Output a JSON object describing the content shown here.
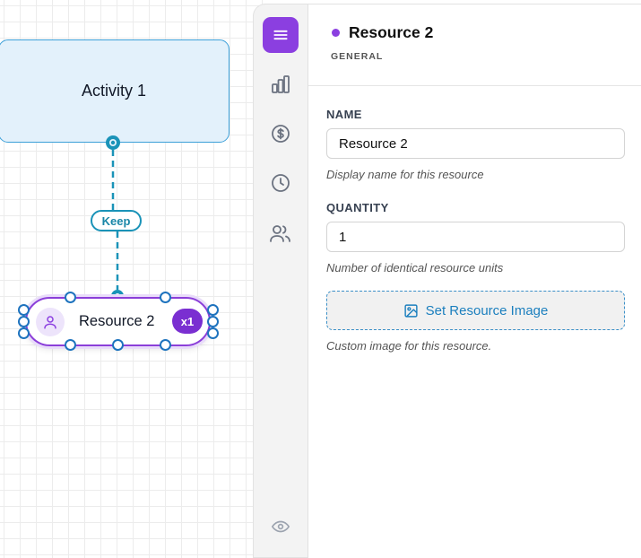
{
  "canvas": {
    "activity_label": "Activity 1",
    "connector_label": "Keep",
    "resource": {
      "label": "Resource 2",
      "quantity_badge": "x1"
    }
  },
  "toolbar": {
    "items": [
      {
        "icon": "menu-icon",
        "active": true
      },
      {
        "icon": "bar-chart-icon"
      },
      {
        "icon": "dollar-icon"
      },
      {
        "icon": "clock-icon"
      },
      {
        "icon": "users-icon"
      },
      {
        "icon": "eye-icon"
      }
    ]
  },
  "panel": {
    "title": "Resource 2",
    "subtitle": "GENERAL",
    "name": {
      "label": "NAME",
      "value": "Resource 2",
      "help": "Display name for this resource"
    },
    "quantity": {
      "label": "QUANTITY",
      "value": "1",
      "help": "Number of identical resource units"
    },
    "image_button": {
      "label": "Set Resource Image",
      "help": "Custom image for this resource."
    }
  },
  "colors": {
    "accent_purple": "#8b3fe0",
    "accent_teal": "#1a93b8",
    "activity_fill": "#e3f1fb",
    "link_blue": "#1b7fbe"
  }
}
